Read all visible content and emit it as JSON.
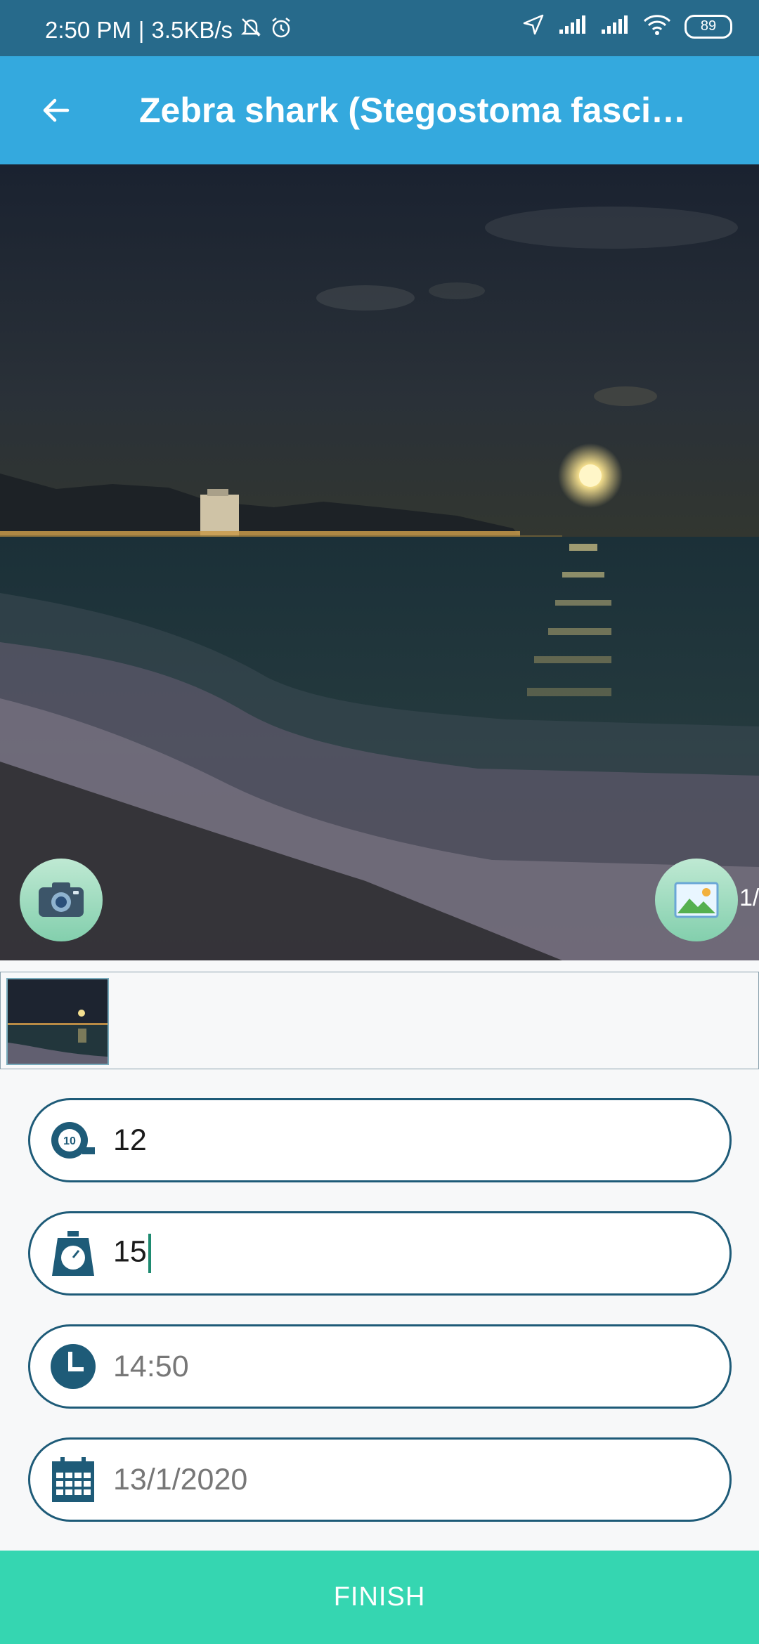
{
  "status_bar": {
    "time": "2:50 PM",
    "speed": "3.5KB/s",
    "battery": "89"
  },
  "app_bar": {
    "title": "Zebra shark (Stegostoma fasci…"
  },
  "photo": {
    "page_indicator": "1/"
  },
  "fields": {
    "length": {
      "value": "12",
      "icon": "tape-measure-icon"
    },
    "weight": {
      "value": "15",
      "icon": "scale-icon"
    },
    "time": {
      "value": "14:50",
      "icon": "clock-icon"
    },
    "date": {
      "value": "13/1/2020",
      "icon": "calendar-icon"
    }
  },
  "finish": {
    "label": "FINISH"
  },
  "colors": {
    "status_bar": "#276a8b",
    "app_bar": "#34a9de",
    "field_border": "#1e5b78",
    "finish_button": "#35d6b1"
  }
}
